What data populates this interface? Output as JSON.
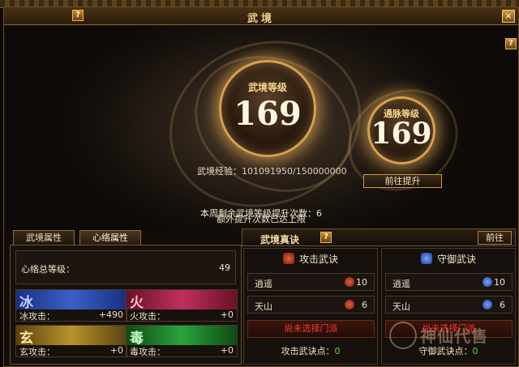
{
  "window": {
    "title": "武境",
    "help": "?",
    "close": "×"
  },
  "hero": {
    "main_label": "武境等级",
    "main_level": "169",
    "side_label": "通脉等级",
    "side_level": "169",
    "exp_label": "武境经验：",
    "exp_value": "101091950/150000000",
    "goto_button": "前往提升",
    "weekly_text": "本周剩余武境等级提升次数：6",
    "extra_text": "额外提升次数已达上限"
  },
  "left": {
    "tabs": [
      {
        "label": "武境属性"
      },
      {
        "label": "心络属性"
      }
    ],
    "total_label": "心络总等级：",
    "total_value": "49",
    "elements": [
      {
        "glyph": "冰",
        "attack_label": "冰攻击：",
        "attack_value": "+490",
        "color": "#2a4fb0"
      },
      {
        "glyph": "火",
        "attack_label": "火攻击：",
        "attack_value": "+0",
        "color": "#b0284a"
      },
      {
        "glyph": "玄",
        "attack_label": "玄攻击：",
        "attack_value": "+0",
        "color": "#9a7a1a"
      },
      {
        "glyph": "毒",
        "attack_label": "毒攻击：",
        "attack_value": "+0",
        "color": "#1f8a2a"
      }
    ]
  },
  "right": {
    "title": "武境真诀",
    "back_button": "前往",
    "attack": {
      "heading": "攻击武诀",
      "rows": [
        {
          "name": "逍遥",
          "level": "10"
        },
        {
          "name": "天山",
          "level": "6"
        }
      ],
      "no_selection": "尚未选择门派",
      "points_label": "攻击武诀点：",
      "points_value": "0",
      "icon_color": "#c0402a"
    },
    "defense": {
      "heading": "守御武诀",
      "rows": [
        {
          "name": "逍遥",
          "level": "10"
        },
        {
          "name": "天山",
          "level": "6"
        }
      ],
      "no_selection": "尚未选择门派",
      "points_label": "守御武诀点：",
      "points_value": "0",
      "icon_color": "#3a6ad8"
    }
  },
  "watermark": {
    "text": "神仙代售"
  }
}
